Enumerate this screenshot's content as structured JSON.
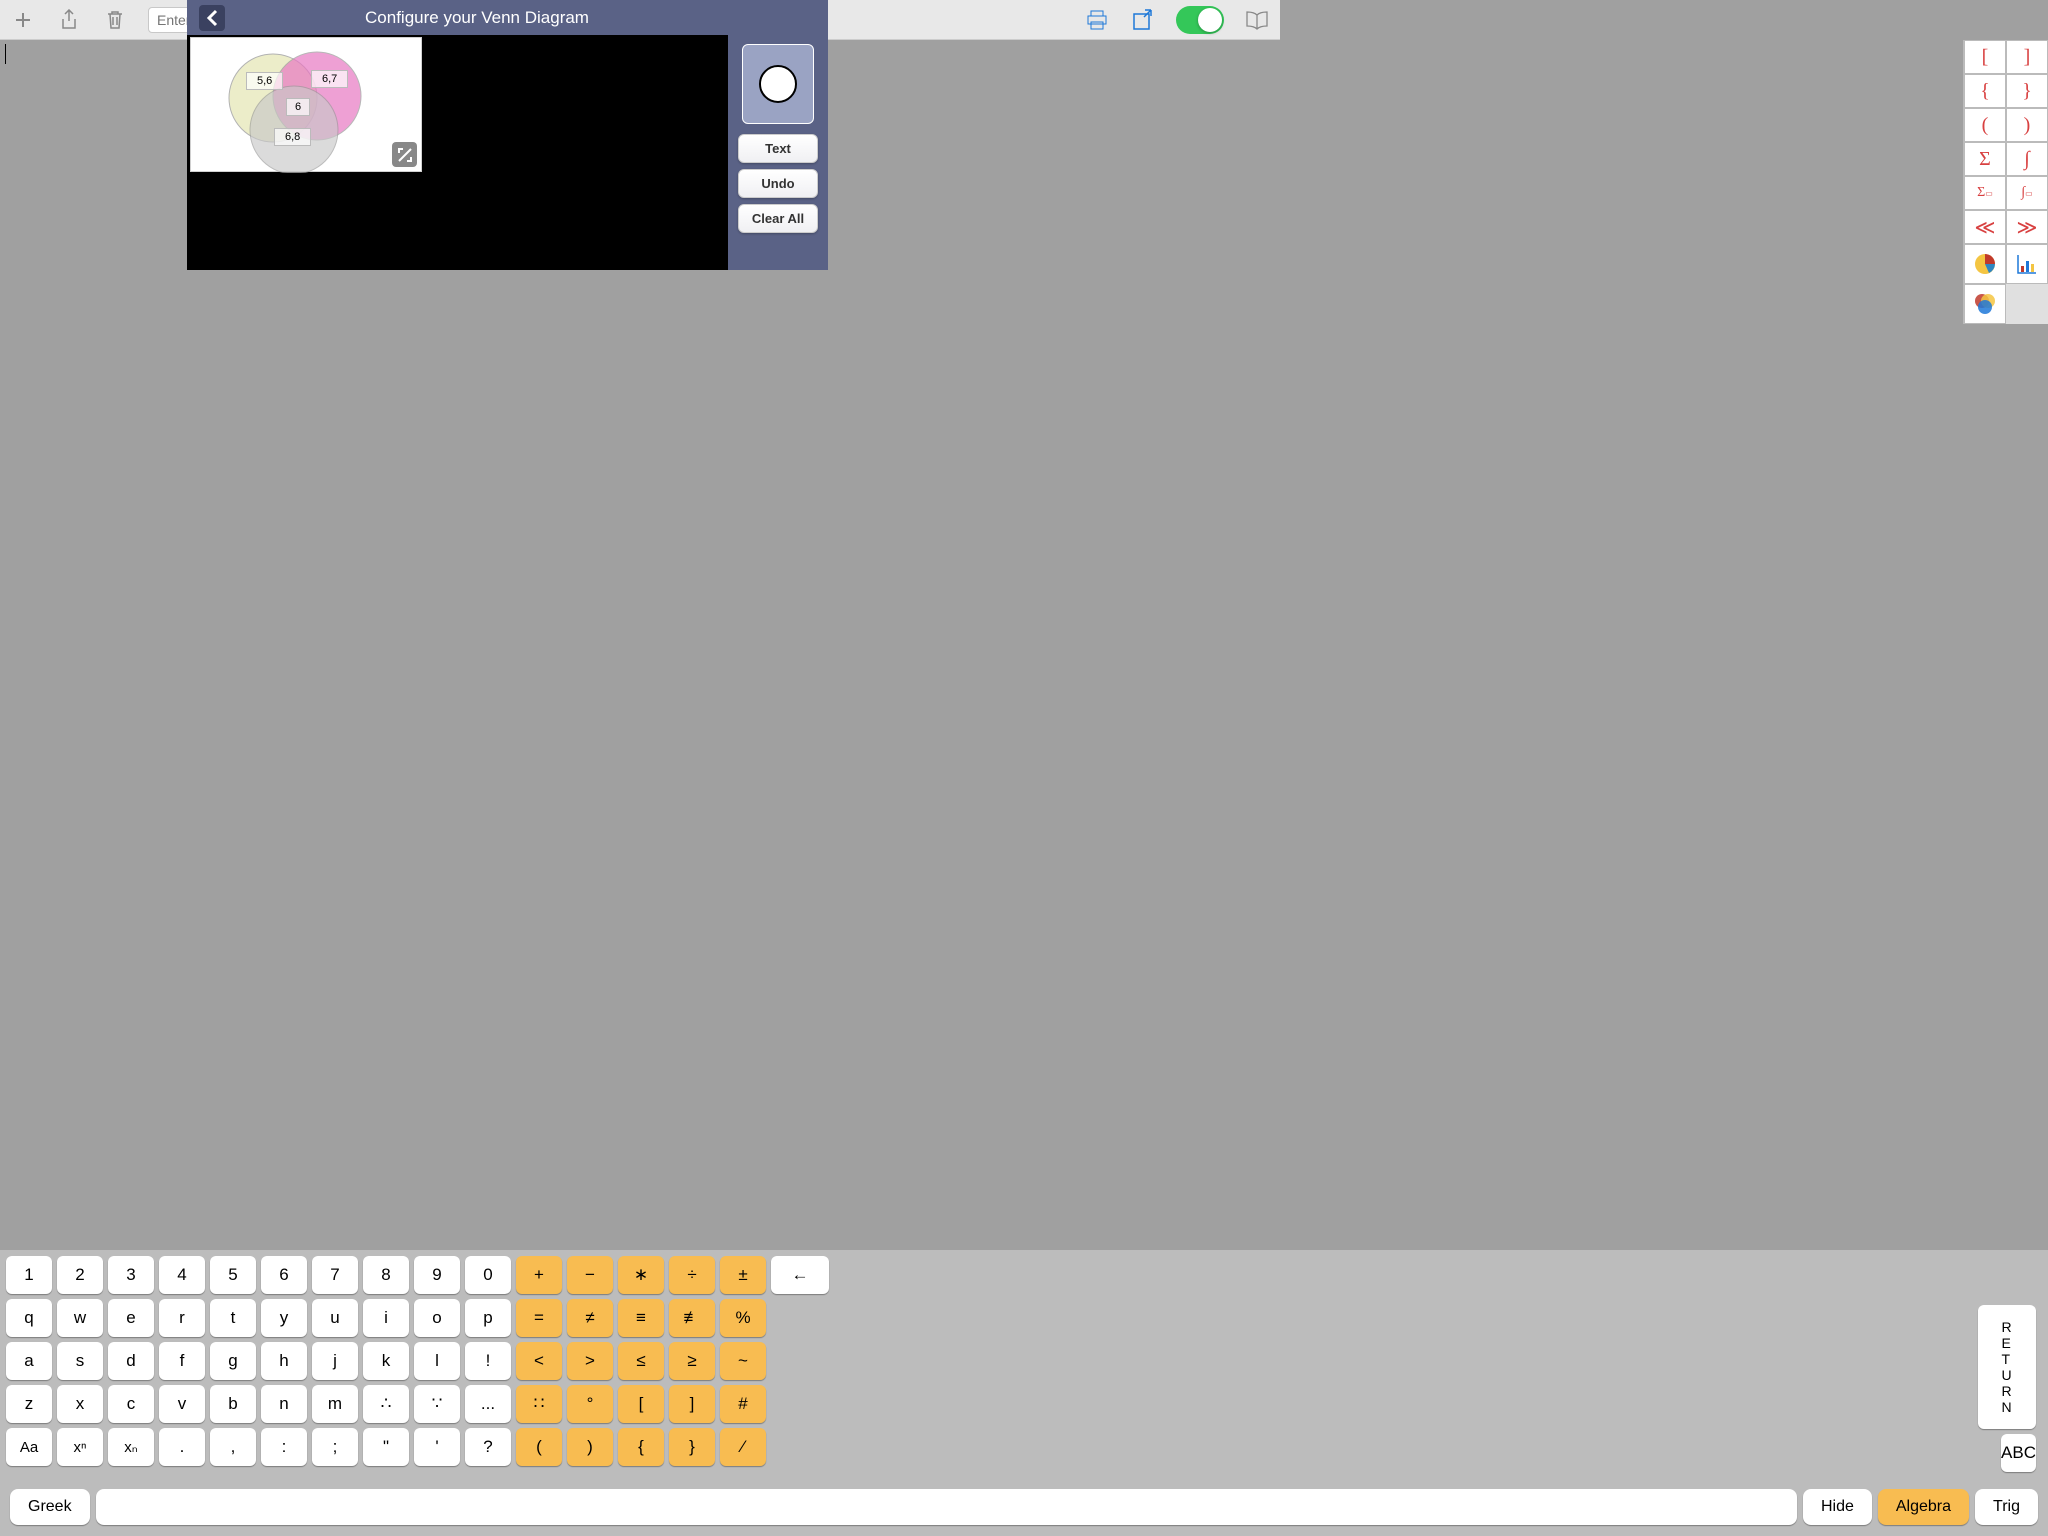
{
  "toolbar": {
    "file_placeholder": "Enter file"
  },
  "modal": {
    "title": "Configure your Venn Diagram",
    "buttons": {
      "text": "Text",
      "undo": "Undo",
      "clear": "Clear All"
    },
    "venn_labels": {
      "a": "5,6",
      "b": "6,7",
      "c": "6,8",
      "center": "6"
    }
  },
  "symbol_rail": [
    "[",
    "]",
    "{",
    "}",
    "(",
    ")",
    "Σ",
    "∫",
    "Σ̲",
    "∫̲",
    "≪",
    "≫"
  ],
  "keyboard": {
    "row1": [
      "1",
      "2",
      "3",
      "4",
      "5",
      "6",
      "7",
      "8",
      "9",
      "0"
    ],
    "row1ops": [
      "+",
      "−",
      "∗",
      "÷",
      "±"
    ],
    "backspace": "←",
    "row2": [
      "q",
      "w",
      "e",
      "r",
      "t",
      "y",
      "u",
      "i",
      "o",
      "p"
    ],
    "row2ops": [
      "=",
      "≠",
      "≡",
      "≢",
      "%"
    ],
    "row3": [
      "a",
      "s",
      "d",
      "f",
      "g",
      "h",
      "j",
      "k",
      "l",
      "!"
    ],
    "row3ops": [
      "<",
      ">",
      "≤",
      "≥",
      "~"
    ],
    "row4": [
      "z",
      "x",
      "c",
      "v",
      "b",
      "n",
      "m",
      "∴",
      "∵",
      "..."
    ],
    "row4ops": [
      "∷",
      "°",
      "[",
      "]",
      "#"
    ],
    "row5": [
      "Aa",
      "xⁿ",
      "xₙ",
      ".",
      ",",
      ":",
      ";",
      "\"",
      "'",
      "?"
    ],
    "row5ops": [
      "(",
      ")",
      "{",
      "}",
      "⁄"
    ],
    "return": "R\nE\nT\nU\nR\nN",
    "abc": "ABC",
    "bottom": {
      "greek": "Greek",
      "hide": "Hide",
      "algebra": "Algebra",
      "trig": "Trig"
    }
  }
}
